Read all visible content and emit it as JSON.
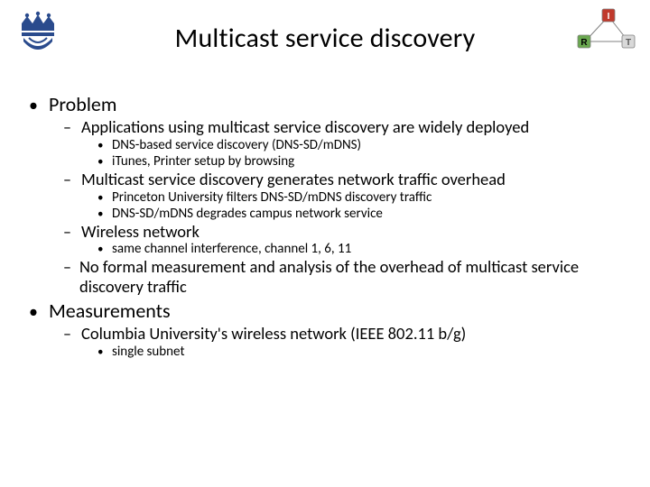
{
  "title": "Multicast service discovery",
  "corner_nodes": {
    "top": "I",
    "left": "R",
    "right": "T"
  },
  "bullets": {
    "l1_0": "Problem",
    "l1_0_l2_0": "Applications using multicast service discovery are widely deployed",
    "l1_0_l2_0_l3_0": "DNS-based service discovery (DNS-SD/mDNS)",
    "l1_0_l2_0_l3_1": "iTunes, Printer setup by browsing",
    "l1_0_l2_1": "Multicast service discovery generates network traffic overhead",
    "l1_0_l2_1_l3_0": "Princeton University filters DNS-SD/mDNS discovery traffic",
    "l1_0_l2_1_l3_1": "DNS-SD/mDNS degrades campus network service",
    "l1_0_l2_2": "Wireless network",
    "l1_0_l2_2_l3_0": "same channel interference, channel 1, 6, 11",
    "l1_0_l2_3": "No formal measurement and analysis of the overhead of multicast service discovery traffic",
    "l1_1": "Measurements",
    "l1_1_l2_0": "Columbia University's wireless network (IEEE 802.11 b/g)",
    "l1_1_l2_0_l3_0": "single subnet"
  }
}
